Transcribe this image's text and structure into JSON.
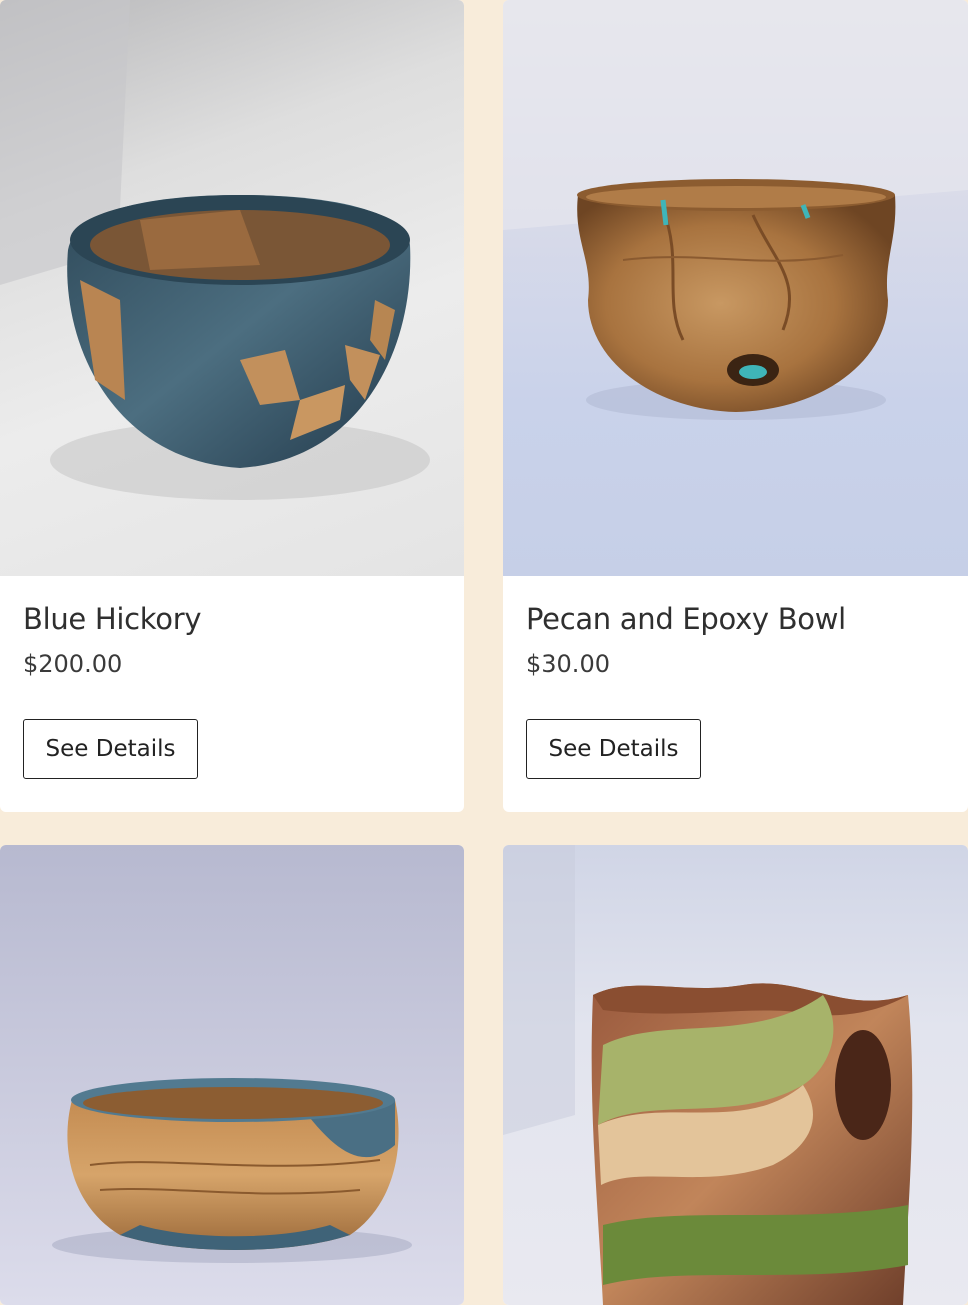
{
  "products": [
    {
      "title": "Blue Hickory",
      "price": "$200.00",
      "button_label": "See Details",
      "image_label": "product-photo-blue-hickory"
    },
    {
      "title": "Pecan and Epoxy Bowl",
      "price": "$30.00",
      "button_label": "See Details",
      "image_label": "product-photo-pecan-epoxy-bowl"
    },
    {
      "title": "",
      "price": "",
      "button_label": "",
      "image_label": "product-photo-blue-rim-bowl"
    },
    {
      "title": "",
      "price": "",
      "button_label": "",
      "image_label": "product-photo-green-wavy-bowl"
    }
  ],
  "colors": {
    "page_background": "#f8ecda",
    "card_background": "#ffffff",
    "text": "#2f2f2f",
    "button_border": "#222222"
  }
}
